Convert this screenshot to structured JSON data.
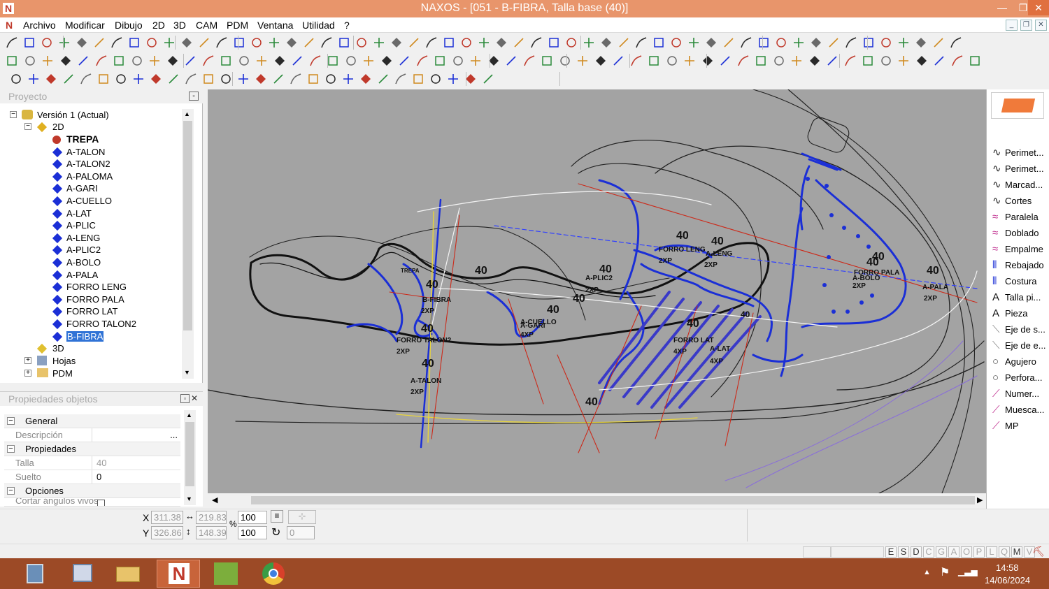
{
  "titlebar": {
    "title": "NAXOS - [051 - B-FIBRA, Talla base (40)]",
    "app_icon": "N"
  },
  "menu": [
    "Archivo",
    "Modificar",
    "Dibujo",
    "2D",
    "3D",
    "CAM",
    "PDM",
    "Ventana",
    "Utilidad",
    "?"
  ],
  "project_panel": {
    "title": "Proyecto",
    "root": "Versión 1 (Actual)",
    "node_2d": "2D",
    "items": [
      {
        "label": "TREPA",
        "bold": true,
        "color": "#c0392b"
      },
      {
        "label": "A-TALON"
      },
      {
        "label": "A-TALON2"
      },
      {
        "label": "A-PALOMA"
      },
      {
        "label": "A-GARI"
      },
      {
        "label": "A-CUELLO"
      },
      {
        "label": "A-LAT"
      },
      {
        "label": "A-PLIC"
      },
      {
        "label": "A-LENG"
      },
      {
        "label": "A-PLIC2"
      },
      {
        "label": "A-BOLO"
      },
      {
        "label": "A-PALA"
      },
      {
        "label": "FORRO LENG"
      },
      {
        "label": "FORRO PALA"
      },
      {
        "label": "FORRO LAT"
      },
      {
        "label": "FORRO TALON2"
      },
      {
        "label": "B-FIBRA",
        "selected": true
      }
    ],
    "node_3d": "3D",
    "node_hojas": "Hojas",
    "node_pdm": "PDM"
  },
  "props_panel": {
    "title": "Propiedades objetos",
    "general": "General",
    "descripcion_label": "Descripción",
    "descripcion_btn": "...",
    "propiedades": "Propiedades",
    "talla_label": "Talla",
    "talla_value": "40",
    "suelto_label": "Suelto",
    "suelto_value": "0",
    "opciones": "Opciones",
    "cortar_label": "Cortar ángulos vivos"
  },
  "canvas_labels": {
    "size": "40",
    "trepa": "TREPA",
    "b_fibra": "B-FIBRA",
    "forro_talon2": "FORRO TALON2",
    "a_talon": "A-TALON",
    "a_cuello": "A-CUELLO",
    "a_gari": "A-GARI",
    "a_plic2": "A-PLIC2",
    "forro_leng": "FORRO LENG",
    "a_leng": "A-LENG",
    "forro_lat": "FORRO LAT",
    "a_lat": "A-LAT",
    "forro_pala": "FORRO PALA",
    "a_bolo": "A-BOLO",
    "a_pala": "A-PALA",
    "q2": "2XP",
    "q4": "4XP"
  },
  "right_panel": {
    "items": [
      "Perimet...",
      "Perimet...",
      "Marcad...",
      "Cortes",
      "Paralela",
      "Doblado",
      "Empalme",
      "Rebajado",
      "Costura",
      "Talla pi...",
      "Pieza",
      "Eje de s...",
      "Eje de e...",
      "Agujero",
      "Perfora...",
      "Numer...",
      "Muesca...",
      "MP"
    ]
  },
  "coords": {
    "x_label": "X",
    "y_label": "Y",
    "x": "311.38",
    "y": "326.86",
    "w": "219.83",
    "h": "148.39",
    "scale_x": "100",
    "scale_y": "100",
    "pct": "%",
    "rotation": "0"
  },
  "status_letters": [
    "E",
    "S",
    "D",
    "C",
    "G",
    "A",
    "O",
    "P",
    "L",
    "Q",
    "M",
    "V"
  ],
  "taskbar": {
    "time": "14:58",
    "date": "14/06/2024"
  },
  "colors": {
    "titlebar": "#e8956b",
    "canvas": "#a3a3a3",
    "taskbar": "#9c4a26",
    "selection": "#3073d6",
    "piece_blue": "#1b2fd6"
  }
}
